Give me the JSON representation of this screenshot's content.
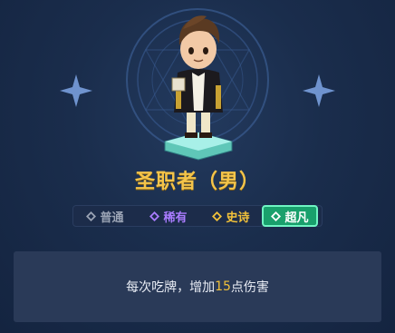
{
  "character": {
    "name": "圣职者（男）"
  },
  "rarity_tabs": [
    {
      "label": "普通",
      "color": "#9aa3b4",
      "icon": "gem-icon"
    },
    {
      "label": "稀有",
      "color": "#a97cff",
      "icon": "gem-icon"
    },
    {
      "label": "史诗",
      "color": "#f2c23a",
      "icon": "gem-icon"
    },
    {
      "label": "超凡",
      "color": "#19a06c",
      "icon": "gem-icon",
      "selected": true
    }
  ],
  "description": {
    "prefix": "每次吃牌，增加",
    "value": "15",
    "suffix": "点伤害"
  },
  "colors": {
    "name_gold": "#f4c44a",
    "highlight": "#f2c23a",
    "selected_tab": "#19a06c"
  }
}
